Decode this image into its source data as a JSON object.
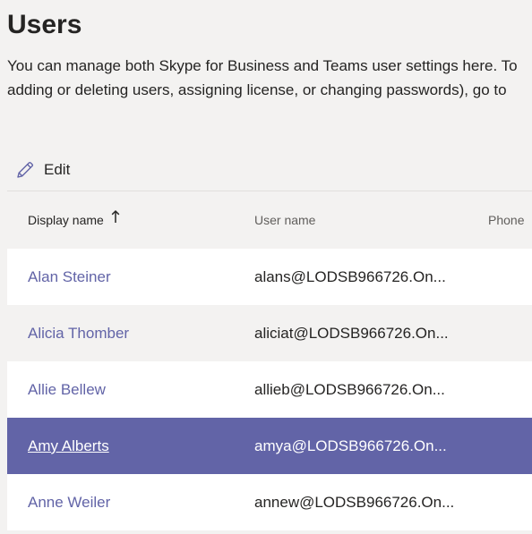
{
  "page": {
    "title": "Users",
    "description_line1": "You can manage both Skype for Business and Teams user settings here. To",
    "description_line2": "adding or deleting users, assigning license, or changing passwords), go to"
  },
  "toolbar": {
    "edit_label": "Edit",
    "edit_icon": "pencil-icon"
  },
  "table": {
    "columns": {
      "display_name": "Display name",
      "user_name": "User name",
      "phone": "Phone"
    },
    "sort": {
      "column": "Display name",
      "direction": "ascending",
      "icon": "arrow-up-icon"
    },
    "rows": [
      {
        "display_name": "Alan Steiner",
        "user_name": "alans@LODSB966726.On...",
        "selected": false
      },
      {
        "display_name": "Alicia Thomber",
        "user_name": "aliciat@LODSB966726.On...",
        "selected": false
      },
      {
        "display_name": "Allie Bellew",
        "user_name": "allieb@LODSB966726.On...",
        "selected": false
      },
      {
        "display_name": "Amy Alberts",
        "user_name": "amya@LODSB966726.On...",
        "selected": true
      },
      {
        "display_name": "Anne Weiler",
        "user_name": "annew@LODSB966726.On...",
        "selected": false
      }
    ]
  },
  "colors": {
    "accent": "#6264a7",
    "background": "#f3f2f1",
    "row_white": "#ffffff",
    "text": "#252423",
    "muted_text": "#605e5c"
  }
}
